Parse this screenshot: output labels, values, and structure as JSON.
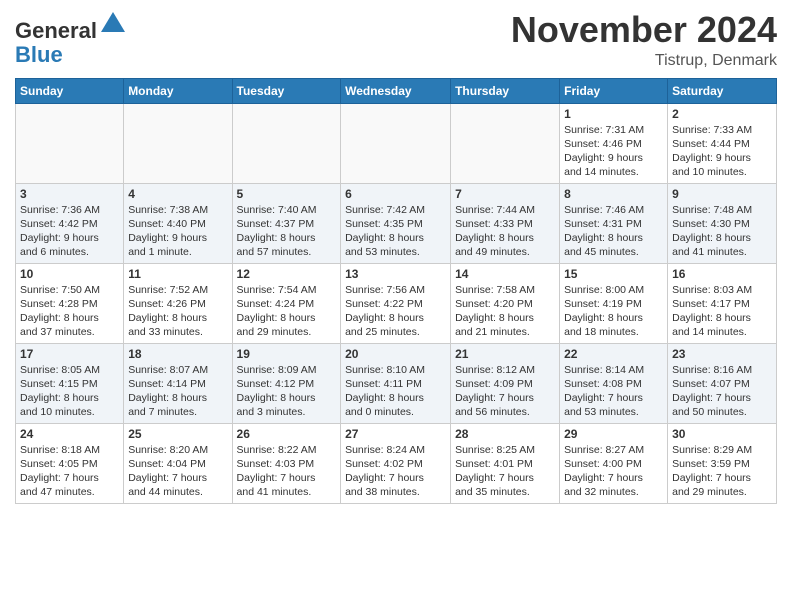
{
  "header": {
    "logo_general": "General",
    "logo_blue": "Blue",
    "month_title": "November 2024",
    "location": "Tistrup, Denmark"
  },
  "weekdays": [
    "Sunday",
    "Monday",
    "Tuesday",
    "Wednesday",
    "Thursday",
    "Friday",
    "Saturday"
  ],
  "weeks": [
    [
      {
        "day": "",
        "info": ""
      },
      {
        "day": "",
        "info": ""
      },
      {
        "day": "",
        "info": ""
      },
      {
        "day": "",
        "info": ""
      },
      {
        "day": "",
        "info": ""
      },
      {
        "day": "1",
        "info": "Sunrise: 7:31 AM\nSunset: 4:46 PM\nDaylight: 9 hours\nand 14 minutes."
      },
      {
        "day": "2",
        "info": "Sunrise: 7:33 AM\nSunset: 4:44 PM\nDaylight: 9 hours\nand 10 minutes."
      }
    ],
    [
      {
        "day": "3",
        "info": "Sunrise: 7:36 AM\nSunset: 4:42 PM\nDaylight: 9 hours\nand 6 minutes."
      },
      {
        "day": "4",
        "info": "Sunrise: 7:38 AM\nSunset: 4:40 PM\nDaylight: 9 hours\nand 1 minute."
      },
      {
        "day": "5",
        "info": "Sunrise: 7:40 AM\nSunset: 4:37 PM\nDaylight: 8 hours\nand 57 minutes."
      },
      {
        "day": "6",
        "info": "Sunrise: 7:42 AM\nSunset: 4:35 PM\nDaylight: 8 hours\nand 53 minutes."
      },
      {
        "day": "7",
        "info": "Sunrise: 7:44 AM\nSunset: 4:33 PM\nDaylight: 8 hours\nand 49 minutes."
      },
      {
        "day": "8",
        "info": "Sunrise: 7:46 AM\nSunset: 4:31 PM\nDaylight: 8 hours\nand 45 minutes."
      },
      {
        "day": "9",
        "info": "Sunrise: 7:48 AM\nSunset: 4:30 PM\nDaylight: 8 hours\nand 41 minutes."
      }
    ],
    [
      {
        "day": "10",
        "info": "Sunrise: 7:50 AM\nSunset: 4:28 PM\nDaylight: 8 hours\nand 37 minutes."
      },
      {
        "day": "11",
        "info": "Sunrise: 7:52 AM\nSunset: 4:26 PM\nDaylight: 8 hours\nand 33 minutes."
      },
      {
        "day": "12",
        "info": "Sunrise: 7:54 AM\nSunset: 4:24 PM\nDaylight: 8 hours\nand 29 minutes."
      },
      {
        "day": "13",
        "info": "Sunrise: 7:56 AM\nSunset: 4:22 PM\nDaylight: 8 hours\nand 25 minutes."
      },
      {
        "day": "14",
        "info": "Sunrise: 7:58 AM\nSunset: 4:20 PM\nDaylight: 8 hours\nand 21 minutes."
      },
      {
        "day": "15",
        "info": "Sunrise: 8:00 AM\nSunset: 4:19 PM\nDaylight: 8 hours\nand 18 minutes."
      },
      {
        "day": "16",
        "info": "Sunrise: 8:03 AM\nSunset: 4:17 PM\nDaylight: 8 hours\nand 14 minutes."
      }
    ],
    [
      {
        "day": "17",
        "info": "Sunrise: 8:05 AM\nSunset: 4:15 PM\nDaylight: 8 hours\nand 10 minutes."
      },
      {
        "day": "18",
        "info": "Sunrise: 8:07 AM\nSunset: 4:14 PM\nDaylight: 8 hours\nand 7 minutes."
      },
      {
        "day": "19",
        "info": "Sunrise: 8:09 AM\nSunset: 4:12 PM\nDaylight: 8 hours\nand 3 minutes."
      },
      {
        "day": "20",
        "info": "Sunrise: 8:10 AM\nSunset: 4:11 PM\nDaylight: 8 hours\nand 0 minutes."
      },
      {
        "day": "21",
        "info": "Sunrise: 8:12 AM\nSunset: 4:09 PM\nDaylight: 7 hours\nand 56 minutes."
      },
      {
        "day": "22",
        "info": "Sunrise: 8:14 AM\nSunset: 4:08 PM\nDaylight: 7 hours\nand 53 minutes."
      },
      {
        "day": "23",
        "info": "Sunrise: 8:16 AM\nSunset: 4:07 PM\nDaylight: 7 hours\nand 50 minutes."
      }
    ],
    [
      {
        "day": "24",
        "info": "Sunrise: 8:18 AM\nSunset: 4:05 PM\nDaylight: 7 hours\nand 47 minutes."
      },
      {
        "day": "25",
        "info": "Sunrise: 8:20 AM\nSunset: 4:04 PM\nDaylight: 7 hours\nand 44 minutes."
      },
      {
        "day": "26",
        "info": "Sunrise: 8:22 AM\nSunset: 4:03 PM\nDaylight: 7 hours\nand 41 minutes."
      },
      {
        "day": "27",
        "info": "Sunrise: 8:24 AM\nSunset: 4:02 PM\nDaylight: 7 hours\nand 38 minutes."
      },
      {
        "day": "28",
        "info": "Sunrise: 8:25 AM\nSunset: 4:01 PM\nDaylight: 7 hours\nand 35 minutes."
      },
      {
        "day": "29",
        "info": "Sunrise: 8:27 AM\nSunset: 4:00 PM\nDaylight: 7 hours\nand 32 minutes."
      },
      {
        "day": "30",
        "info": "Sunrise: 8:29 AM\nSunset: 3:59 PM\nDaylight: 7 hours\nand 29 minutes."
      }
    ]
  ]
}
